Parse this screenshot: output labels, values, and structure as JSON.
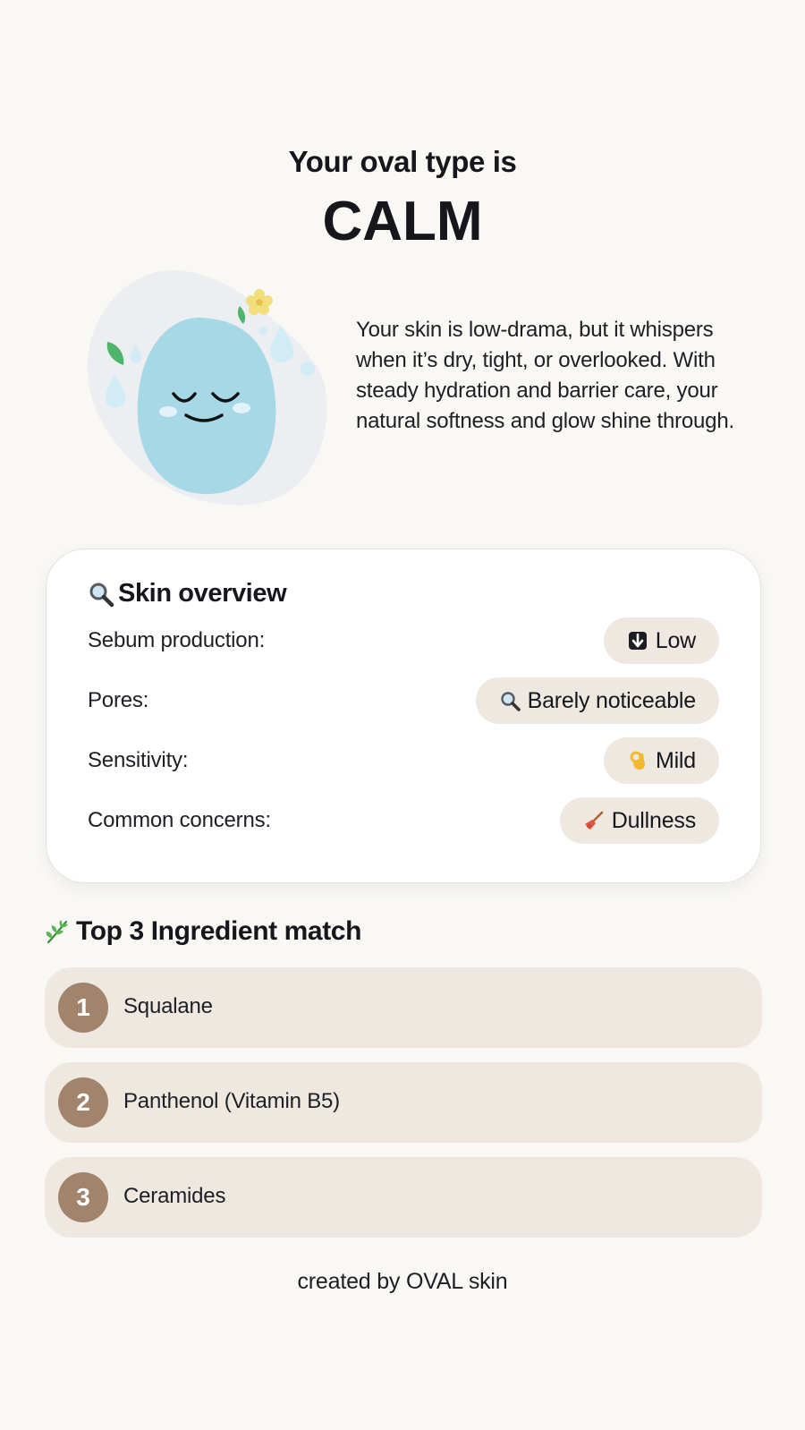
{
  "result": {
    "intro": "Your oval type is",
    "type_name": "CALM",
    "description": "Your skin is low-drama, but it whispers when it’s dry, tight, or overlooked. With steady hydration and barrier care, your natural softness and glow shine through."
  },
  "overview": {
    "title": "Skin overview",
    "title_icon": "magnifier-icon",
    "rows": [
      {
        "label": "Sebum production:",
        "value": "Low",
        "icon": "down-arrow-icon"
      },
      {
        "label": "Pores:",
        "value": "Barely noticeable",
        "icon": "magnifier-icon"
      },
      {
        "label": "Sensitivity:",
        "value": "Mild",
        "icon": "ok-hand-icon"
      },
      {
        "label": "Common concerns:",
        "value": "Dullness",
        "icon": "broom-icon"
      }
    ]
  },
  "ingredients": {
    "title": "Top 3 Ingredient match",
    "title_icon": "herb-icon",
    "items": [
      {
        "rank": "1",
        "name": "Squalane"
      },
      {
        "rank": "2",
        "name": "Panthenol (Vitamin B5)"
      },
      {
        "rank": "3",
        "name": "Ceramides"
      }
    ]
  },
  "footer": {
    "credit": "created by OVAL skin"
  },
  "colors": {
    "background": "#f9f8f5",
    "pill": "#efe8e1",
    "rank_badge": "#a1846b",
    "mascot_body": "#a6d8e6",
    "mascot_backdrop": "#eceef1"
  }
}
